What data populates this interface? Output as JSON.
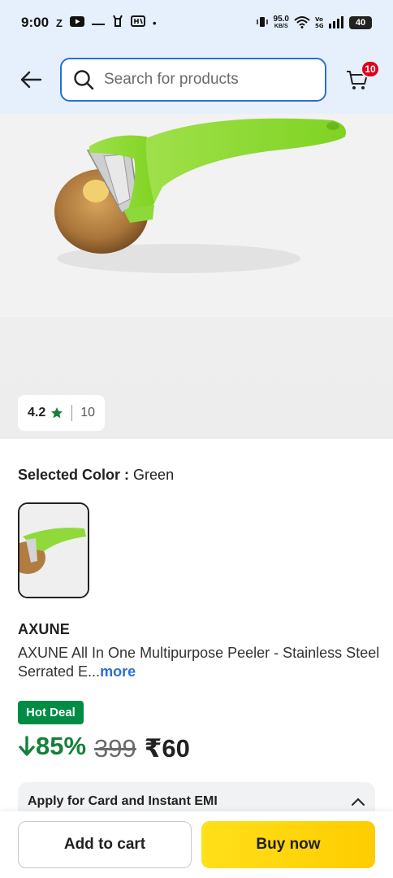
{
  "status_bar": {
    "time": "9:00",
    "app_icons": [
      "Z",
      "youtube-icon",
      "dash-icon",
      "deer-icon",
      "app-icon",
      "•"
    ],
    "net_speed": "95.0",
    "net_speed_unit": "KB/S",
    "battery": "40",
    "icons": [
      "vibrate-icon",
      "wifi-icon",
      "volte-icon",
      "signal-icon",
      "battery-icon"
    ]
  },
  "header": {
    "back_icon": "arrow-left-icon",
    "search_placeholder": "Search for products",
    "cart_count": "10",
    "cart_icon": "cart-icon"
  },
  "product": {
    "rating": "4.2",
    "rating_count": "10",
    "selected_color_label": "Selected Color :",
    "selected_color_value": "Green",
    "brand": "AXUNE",
    "title": "AXUNE All In One Multipurpose Peeler - Stainless Steel Serrated E...",
    "more_label": "more",
    "deal_badge": "Hot Deal",
    "discount": "85%",
    "mrp": "399",
    "price": "₹60"
  },
  "emi": {
    "label": "Apply for Card and Instant EMI"
  },
  "actions": {
    "add_to_cart": "Add to cart",
    "buy_now": "Buy now"
  },
  "colors": {
    "accent_blue": "#2a6fd6",
    "header_bg": "#e6f0fc",
    "deal_green": "#008c45",
    "discount_green": "#14803b",
    "buy_yellow": "#ffd814",
    "badge_red": "#e0001b"
  }
}
